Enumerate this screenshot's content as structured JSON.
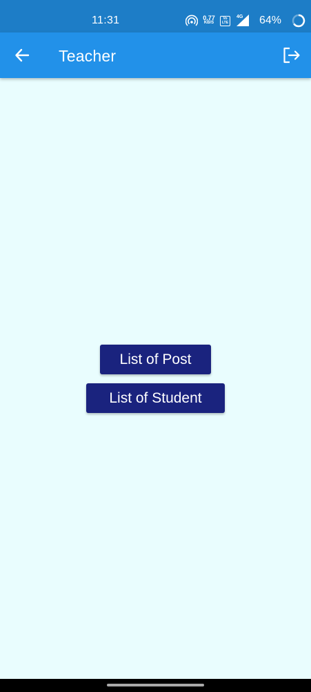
{
  "status_bar": {
    "time": "11:31",
    "net_speed_value": "0.77",
    "net_speed_unit": "KB/S",
    "volte_top": "Vo",
    "volte_bottom": "LTE",
    "network_type": "4G",
    "battery_percent": "64%",
    "icons": [
      "hotspot-icon",
      "volte-icon",
      "signal-icon",
      "battery-ring-icon"
    ]
  },
  "app_bar": {
    "title": "Teacher",
    "back_icon": "arrow-left-icon",
    "logout_icon": "logout-icon",
    "color": "#2291e9"
  },
  "main": {
    "background": "#e9fdfe",
    "buttons": [
      {
        "label": "List of Post"
      },
      {
        "label": "List of Student"
      }
    ],
    "button_color": "#1a237e"
  }
}
